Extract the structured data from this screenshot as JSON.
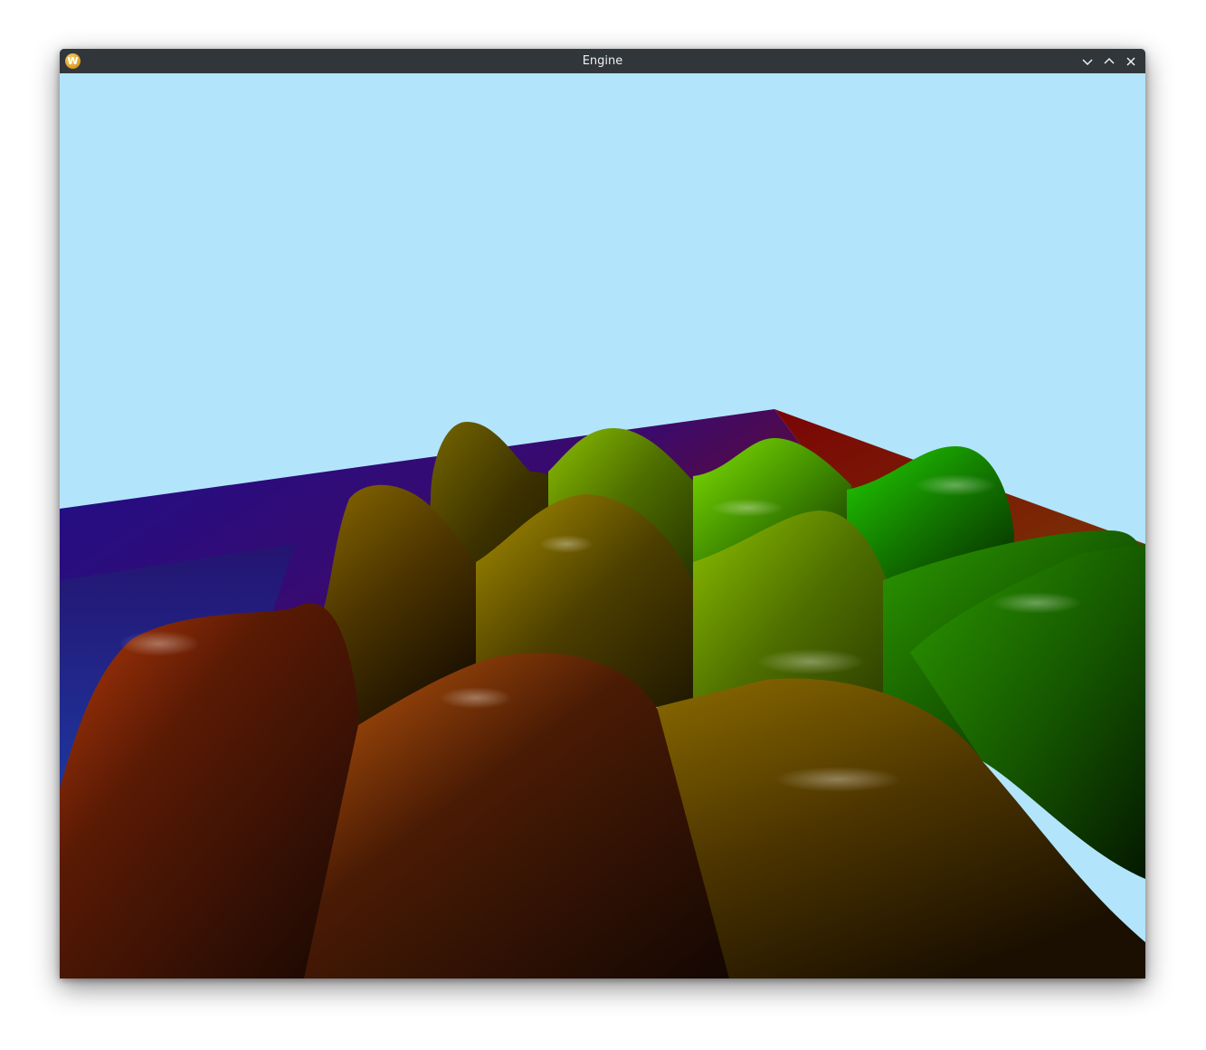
{
  "window": {
    "title": "Engine",
    "app_icon": "kwin-w-icon",
    "app_icon_letter": "W",
    "controls": [
      "minimize-icon",
      "maximize-icon",
      "close-icon"
    ]
  },
  "scene": {
    "sky_color": "#b2e5fb",
    "floor_colors": [
      "#1d0f8a",
      "#7a0a0a",
      "#7a3a05",
      "#1a4fc0"
    ],
    "blob_colors": [
      "#8a2a05",
      "#c28a00",
      "#7fd400",
      "#16c000"
    ]
  }
}
